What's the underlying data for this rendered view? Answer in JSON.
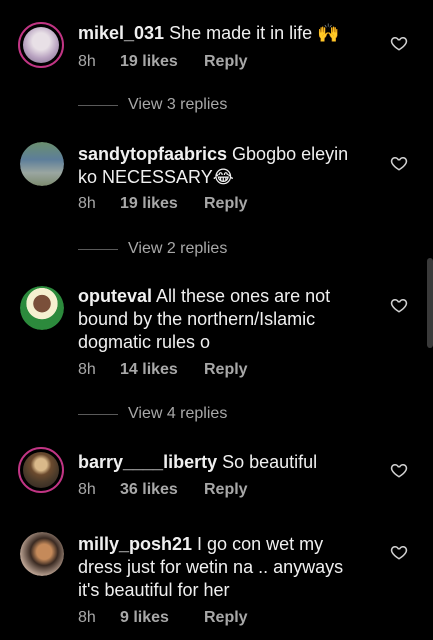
{
  "comments": [
    {
      "user": "mikel_031",
      "text": " She made it in life 🙌",
      "time": "8h",
      "likes": "19 likes",
      "reply": "Reply",
      "replies": "View 3 replies"
    },
    {
      "user": "sandytopfaabrics",
      "text": " Gbogbo eleyin ko NECESSARY😂",
      "time": "8h",
      "likes": "19 likes",
      "reply": "Reply",
      "replies": "View 2 replies"
    },
    {
      "user": "oputeval",
      "text": " All these ones are not bound by the northern/Islamic dogmatic rules o",
      "time": "8h",
      "likes": "14 likes",
      "reply": "Reply",
      "replies": "View 4 replies"
    },
    {
      "user": "barry____liberty",
      "text": " So beautiful",
      "time": "8h",
      "likes": "36 likes",
      "reply": "Reply",
      "replies": ""
    },
    {
      "user": "milly_posh21",
      "text": " I go con wet my dress just for wetin na .. anyways it's beautiful for her",
      "time": "8h",
      "likes": "9 likes",
      "reply": "Reply",
      "replies": ""
    }
  ],
  "colors": {
    "accent_ring": "#c13584",
    "secondary_text": "#a8a8a8",
    "background": "#000000"
  },
  "icons": {
    "like": "heart-outline-icon"
  }
}
